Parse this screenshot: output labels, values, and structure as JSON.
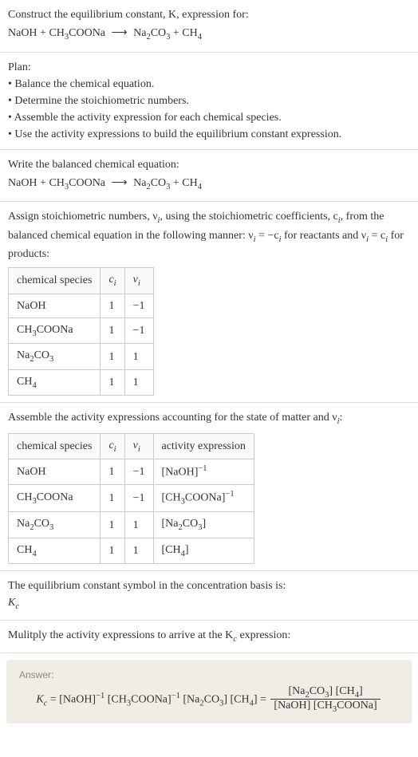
{
  "prompt": {
    "line1": "Construct the equilibrium constant, K, expression for:",
    "eq_lhs1": "NaOH + CH",
    "eq_lhs2": "COONa",
    "eq_rhs1": "Na",
    "eq_rhs2": "CO",
    "eq_rhs3": " + CH"
  },
  "plan": {
    "title": "Plan:",
    "b1": "• Balance the chemical equation.",
    "b2": "• Determine the stoichiometric numbers.",
    "b3": "• Assemble the activity expression for each chemical species.",
    "b4": "• Use the activity expressions to build the equilibrium constant expression."
  },
  "balanced": {
    "title": "Write the balanced chemical equation:"
  },
  "stoich": {
    "intro1": "Assign stoichiometric numbers, ν",
    "intro2": ", using the stoichiometric coefficients, c",
    "intro3": ", from the balanced chemical equation in the following manner: ν",
    "intro4": " = −c",
    "intro5": " for reactants and ν",
    "intro6": " = c",
    "intro7": " for products:",
    "h1": "chemical species",
    "h2": "c",
    "h3": "ν",
    "r1c1a": "NaOH",
    "r1c2": "1",
    "r1c3": "−1",
    "r2c1a": "CH",
    "r2c1b": "COONa",
    "r2c2": "1",
    "r2c3": "−1",
    "r3c1a": "Na",
    "r3c1b": "CO",
    "r3c2": "1",
    "r3c3": "1",
    "r4c1a": "CH",
    "r4c2": "1",
    "r4c3": "1"
  },
  "activity": {
    "title": "Assemble the activity expressions accounting for the state of matter and ν",
    "title2": ":",
    "h4": "activity expression",
    "a1a": "[NaOH]",
    "a2a": "[CH",
    "a2b": "COONa]",
    "a3a": "[Na",
    "a3b": "CO",
    "a3c": "]",
    "a4a": "[CH",
    "a4b": "]"
  },
  "symbol": {
    "line1": "The equilibrium constant symbol in the concentration basis is:",
    "line2": "K"
  },
  "multiply": {
    "title": "Mulitply the activity expressions to arrive at the K",
    "title2": " expression:"
  },
  "answer": {
    "label": "Answer:",
    "k": "K",
    "eq": " = [NaOH]",
    "eq2": " [CH",
    "eq2b": "COONa]",
    "eq3": " [Na",
    "eq3b": "CO",
    "eq3c": "] [CH",
    "eq3d": "] = ",
    "num1": "[Na",
    "num2": "CO",
    "num3": "] [CH",
    "num4": "]",
    "den1": "[NaOH] [CH",
    "den2": "COONa]"
  },
  "sub3": "3",
  "sub2": "2",
  "sub4": "4",
  "subi": "i",
  "subc": "c",
  "supn1": "−1"
}
